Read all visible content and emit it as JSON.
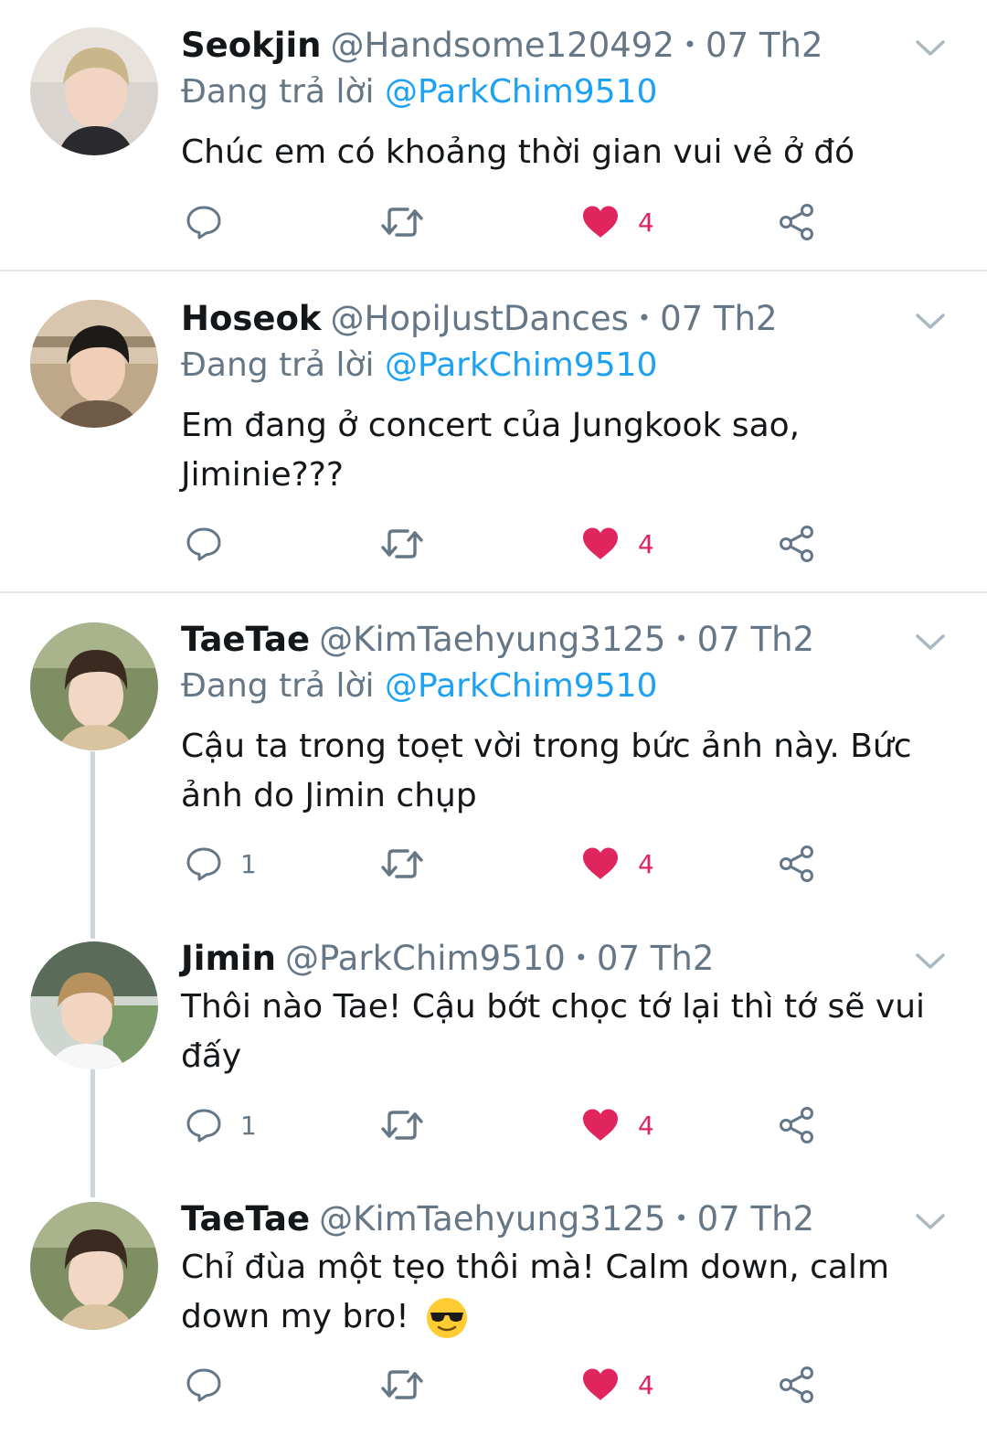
{
  "tweets": [
    {
      "name": "Seokjin",
      "handle": "@Handsome120492",
      "dot": "•",
      "time": "07 Th2",
      "reply_prefix": "Đang trả lời",
      "reply_to": "@ParkChim9510",
      "text": "Chúc em có khoảng thời gian vui vẻ ở đó",
      "reply_count": "",
      "like_count": "4"
    },
    {
      "name": "Hoseok",
      "handle": "@HopiJustDances",
      "dot": "•",
      "time": "07 Th2",
      "reply_prefix": "Đang trả lời",
      "reply_to": "@ParkChim9510",
      "text": "Em đang ở concert của Jungkook sao, Jiminie???",
      "reply_count": "",
      "like_count": "4"
    },
    {
      "name": "TaeTae",
      "handle": "@KimTaehyung3125",
      "dot": "•",
      "time": "07 Th2",
      "reply_prefix": "Đang trả lời",
      "reply_to": "@ParkChim9510",
      "text": "Cậu ta trong toẹt vời trong bức ảnh này. Bức ảnh do Jimin chụp",
      "reply_count": "1",
      "like_count": "4"
    },
    {
      "name": "Jimin",
      "handle": "@ParkChim9510",
      "dot": "•",
      "time": "07 Th2",
      "text": "Thôi nào Tae! Cậu bớt chọc tớ lại thì tớ sẽ vui đấy",
      "reply_count": "1",
      "like_count": "4"
    },
    {
      "name": "TaeTae",
      "handle": "@KimTaehyung3125",
      "dot": "•",
      "time": "07 Th2",
      "text": "Chỉ đùa một tẹo thôi mà! Calm down, calm down my bro!",
      "emoji": "sunglasses-emoji",
      "reply_count": "",
      "like_count": "4"
    }
  ],
  "icons": {
    "reply": "reply-icon",
    "retweet": "retweet-icon",
    "like": "heart-icon",
    "share": "share-icon",
    "menu": "chevron-down-icon"
  },
  "colors": {
    "accent": "#1da1f2",
    "like": "#e0245e",
    "muted": "#657786",
    "divider": "#e1e8ed"
  }
}
